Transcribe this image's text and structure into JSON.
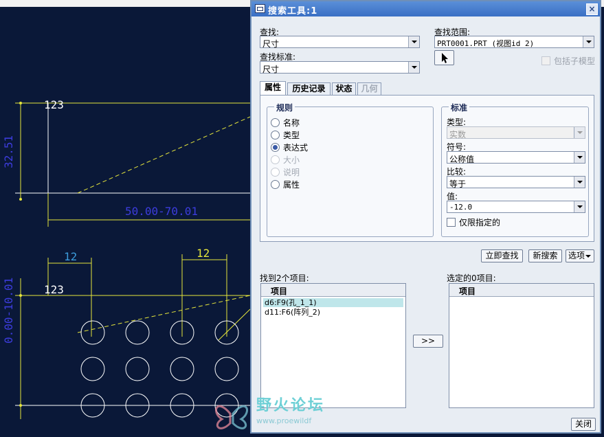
{
  "drawing": {
    "dims": [
      "123",
      "32.51",
      "50.00-70.01",
      "12",
      "12",
      "123",
      "0.00-10.01"
    ]
  },
  "dialog": {
    "title": "搜索工具:1",
    "find_label": "查找:",
    "find_value": "尺寸",
    "scope_label": "查找范围:",
    "scope_value": "PRT0001.PRT (视图id 2)",
    "criteria_label": "查找标准:",
    "criteria_value": "尺寸",
    "include_submodels": "包括子模型",
    "tabs": [
      "属性",
      "历史记录",
      "状态",
      "几何"
    ],
    "rules": {
      "title": "规则",
      "options": [
        "名称",
        "类型",
        "表达式",
        "大小",
        "说明",
        "属性"
      ]
    },
    "standard": {
      "title": "标准",
      "type_label": "类型:",
      "type_value": "实数",
      "symbol_label": "符号:",
      "symbol_value": "公称值",
      "compare_label": "比较:",
      "compare_value": "等于",
      "value_label": "值:",
      "value_value": "-12.0",
      "limit_label": "仅限指定的"
    },
    "buttons": {
      "search_now": "立即查找",
      "new_search": "新搜索",
      "options": "选项",
      "move": ">>",
      "close": "关闭"
    },
    "found": {
      "label": "找到2个项目:",
      "header": "项目",
      "items": [
        "d6:F9(孔_1_1)",
        "d11:F6(阵列_2)"
      ]
    },
    "selected": {
      "label": "选定的0项目:",
      "header": "项目"
    }
  },
  "watermark": {
    "text": "野火论坛",
    "url": "www.proewildf"
  }
}
